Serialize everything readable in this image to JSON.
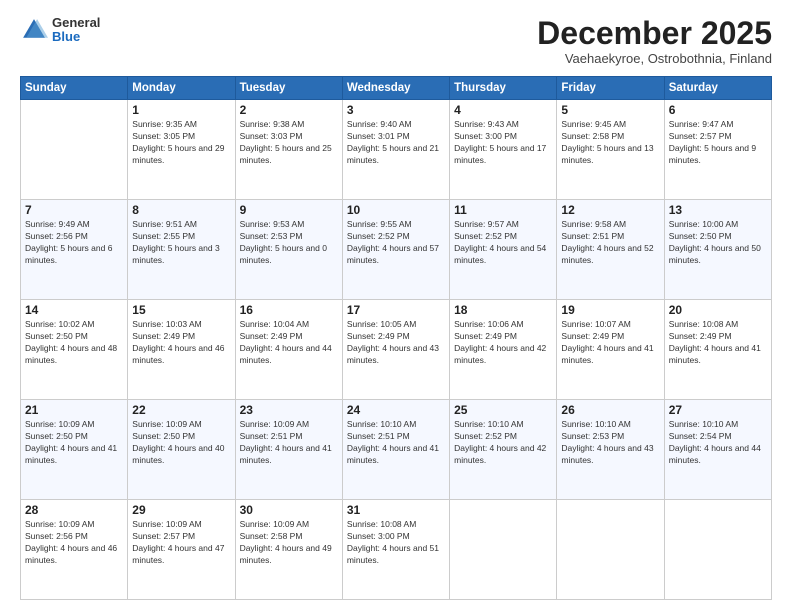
{
  "header": {
    "logo": {
      "general": "General",
      "blue": "Blue"
    },
    "title": "December 2025",
    "subtitle": "Vaehaekyroe, Ostrobothnia, Finland"
  },
  "calendar": {
    "headers": [
      "Sunday",
      "Monday",
      "Tuesday",
      "Wednesday",
      "Thursday",
      "Friday",
      "Saturday"
    ],
    "weeks": [
      [
        {
          "day": "",
          "sunrise": "",
          "sunset": "",
          "daylight": ""
        },
        {
          "day": "1",
          "sunrise": "Sunrise: 9:35 AM",
          "sunset": "Sunset: 3:05 PM",
          "daylight": "Daylight: 5 hours and 29 minutes."
        },
        {
          "day": "2",
          "sunrise": "Sunrise: 9:38 AM",
          "sunset": "Sunset: 3:03 PM",
          "daylight": "Daylight: 5 hours and 25 minutes."
        },
        {
          "day": "3",
          "sunrise": "Sunrise: 9:40 AM",
          "sunset": "Sunset: 3:01 PM",
          "daylight": "Daylight: 5 hours and 21 minutes."
        },
        {
          "day": "4",
          "sunrise": "Sunrise: 9:43 AM",
          "sunset": "Sunset: 3:00 PM",
          "daylight": "Daylight: 5 hours and 17 minutes."
        },
        {
          "day": "5",
          "sunrise": "Sunrise: 9:45 AM",
          "sunset": "Sunset: 2:58 PM",
          "daylight": "Daylight: 5 hours and 13 minutes."
        },
        {
          "day": "6",
          "sunrise": "Sunrise: 9:47 AM",
          "sunset": "Sunset: 2:57 PM",
          "daylight": "Daylight: 5 hours and 9 minutes."
        }
      ],
      [
        {
          "day": "7",
          "sunrise": "Sunrise: 9:49 AM",
          "sunset": "Sunset: 2:56 PM",
          "daylight": "Daylight: 5 hours and 6 minutes."
        },
        {
          "day": "8",
          "sunrise": "Sunrise: 9:51 AM",
          "sunset": "Sunset: 2:55 PM",
          "daylight": "Daylight: 5 hours and 3 minutes."
        },
        {
          "day": "9",
          "sunrise": "Sunrise: 9:53 AM",
          "sunset": "Sunset: 2:53 PM",
          "daylight": "Daylight: 5 hours and 0 minutes."
        },
        {
          "day": "10",
          "sunrise": "Sunrise: 9:55 AM",
          "sunset": "Sunset: 2:52 PM",
          "daylight": "Daylight: 4 hours and 57 minutes."
        },
        {
          "day": "11",
          "sunrise": "Sunrise: 9:57 AM",
          "sunset": "Sunset: 2:52 PM",
          "daylight": "Daylight: 4 hours and 54 minutes."
        },
        {
          "day": "12",
          "sunrise": "Sunrise: 9:58 AM",
          "sunset": "Sunset: 2:51 PM",
          "daylight": "Daylight: 4 hours and 52 minutes."
        },
        {
          "day": "13",
          "sunrise": "Sunrise: 10:00 AM",
          "sunset": "Sunset: 2:50 PM",
          "daylight": "Daylight: 4 hours and 50 minutes."
        }
      ],
      [
        {
          "day": "14",
          "sunrise": "Sunrise: 10:02 AM",
          "sunset": "Sunset: 2:50 PM",
          "daylight": "Daylight: 4 hours and 48 minutes."
        },
        {
          "day": "15",
          "sunrise": "Sunrise: 10:03 AM",
          "sunset": "Sunset: 2:49 PM",
          "daylight": "Daylight: 4 hours and 46 minutes."
        },
        {
          "day": "16",
          "sunrise": "Sunrise: 10:04 AM",
          "sunset": "Sunset: 2:49 PM",
          "daylight": "Daylight: 4 hours and 44 minutes."
        },
        {
          "day": "17",
          "sunrise": "Sunrise: 10:05 AM",
          "sunset": "Sunset: 2:49 PM",
          "daylight": "Daylight: 4 hours and 43 minutes."
        },
        {
          "day": "18",
          "sunrise": "Sunrise: 10:06 AM",
          "sunset": "Sunset: 2:49 PM",
          "daylight": "Daylight: 4 hours and 42 minutes."
        },
        {
          "day": "19",
          "sunrise": "Sunrise: 10:07 AM",
          "sunset": "Sunset: 2:49 PM",
          "daylight": "Daylight: 4 hours and 41 minutes."
        },
        {
          "day": "20",
          "sunrise": "Sunrise: 10:08 AM",
          "sunset": "Sunset: 2:49 PM",
          "daylight": "Daylight: 4 hours and 41 minutes."
        }
      ],
      [
        {
          "day": "21",
          "sunrise": "Sunrise: 10:09 AM",
          "sunset": "Sunset: 2:50 PM",
          "daylight": "Daylight: 4 hours and 41 minutes."
        },
        {
          "day": "22",
          "sunrise": "Sunrise: 10:09 AM",
          "sunset": "Sunset: 2:50 PM",
          "daylight": "Daylight: 4 hours and 40 minutes."
        },
        {
          "day": "23",
          "sunrise": "Sunrise: 10:09 AM",
          "sunset": "Sunset: 2:51 PM",
          "daylight": "Daylight: 4 hours and 41 minutes."
        },
        {
          "day": "24",
          "sunrise": "Sunrise: 10:10 AM",
          "sunset": "Sunset: 2:51 PM",
          "daylight": "Daylight: 4 hours and 41 minutes."
        },
        {
          "day": "25",
          "sunrise": "Sunrise: 10:10 AM",
          "sunset": "Sunset: 2:52 PM",
          "daylight": "Daylight: 4 hours and 42 minutes."
        },
        {
          "day": "26",
          "sunrise": "Sunrise: 10:10 AM",
          "sunset": "Sunset: 2:53 PM",
          "daylight": "Daylight: 4 hours and 43 minutes."
        },
        {
          "day": "27",
          "sunrise": "Sunrise: 10:10 AM",
          "sunset": "Sunset: 2:54 PM",
          "daylight": "Daylight: 4 hours and 44 minutes."
        }
      ],
      [
        {
          "day": "28",
          "sunrise": "Sunrise: 10:09 AM",
          "sunset": "Sunset: 2:56 PM",
          "daylight": "Daylight: 4 hours and 46 minutes."
        },
        {
          "day": "29",
          "sunrise": "Sunrise: 10:09 AM",
          "sunset": "Sunset: 2:57 PM",
          "daylight": "Daylight: 4 hours and 47 minutes."
        },
        {
          "day": "30",
          "sunrise": "Sunrise: 10:09 AM",
          "sunset": "Sunset: 2:58 PM",
          "daylight": "Daylight: 4 hours and 49 minutes."
        },
        {
          "day": "31",
          "sunrise": "Sunrise: 10:08 AM",
          "sunset": "Sunset: 3:00 PM",
          "daylight": "Daylight: 4 hours and 51 minutes."
        },
        {
          "day": "",
          "sunrise": "",
          "sunset": "",
          "daylight": ""
        },
        {
          "day": "",
          "sunrise": "",
          "sunset": "",
          "daylight": ""
        },
        {
          "day": "",
          "sunrise": "",
          "sunset": "",
          "daylight": ""
        }
      ]
    ]
  }
}
